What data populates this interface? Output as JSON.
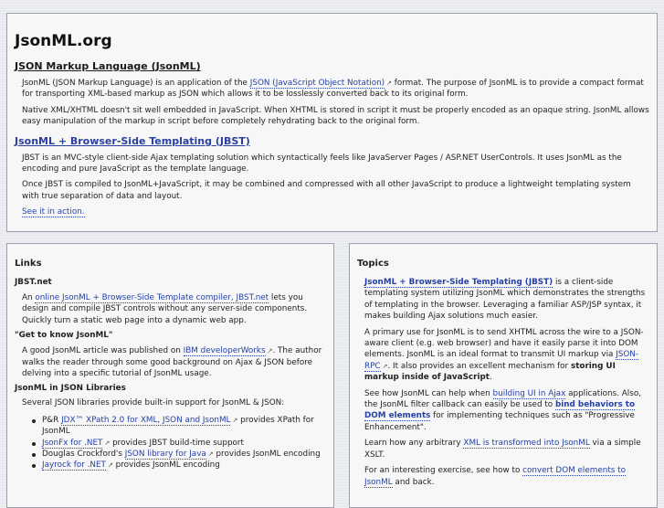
{
  "site": {
    "title": "JsonML.org"
  },
  "top": {
    "section1": {
      "heading": "JSON Markup Language (JsonML)",
      "p1_before": "JsonML (JSON Markup Language) is an application of the ",
      "p1_link": "JSON (JavaScript Object Notation)",
      "p1_after": " format. The purpose of JsonML is to provide a compact format for transporting XML-based markup as JSON which allows it to be losslessly converted back to its original form.",
      "p2": "Native XML/XHTML doesn't sit well embedded in JavaScript. When XHTML is stored in script it must be properly encoded as an opaque string. JsonML allows easy manipulation of the markup in script before completely rehydrating back to the original form."
    },
    "section2": {
      "heading": "JsonML + Browser-Side Templating (JBST)",
      "p1": "JBST is an MVC-style client-side Ajax templating solution which syntactically feels like JavaServer Pages / ASP.NET UserControls. It uses JsonML as the encoding and pure JavaScript as the template language.",
      "p2": "Once JBST is compiled to JsonML+JavaScript, it may be combined and compressed with all other JavaScript to produce a lightweight templating system with true separation of data and layout.",
      "link": "See it in action."
    }
  },
  "links": {
    "title": "Links",
    "jbst": {
      "heading": "JBST.net",
      "before": "An ",
      "link": "online JsonML + Browser-Side Template compiler, JBST.net",
      "after": " lets you design and compile JBST controls without any server-side components. Quickly turn a static web page into a dynamic web app."
    },
    "getknow": {
      "heading": "\"Get to know JsonML\"",
      "before": "A good JsonML article was published on ",
      "link": "IBM developerWorks",
      "after": ". The author walks the reader through some good background on Ajax & JSON before delving into a specific tutorial of JsonML usage."
    },
    "libs": {
      "heading": "JsonML in JSON Libraries",
      "intro": "Several JSON libraries provide built-in support for JsonML & JSON:",
      "items": [
        {
          "before": "P&R ",
          "link": "JDX™ XPath 2.0 for XML, JSON and JsonML",
          "after": " provides XPath for JsonML"
        },
        {
          "before": "",
          "link": "JsonFx for .NET",
          "after": " provides JBST build-time support"
        },
        {
          "before": "Douglas Crockford's ",
          "link": "JSON library for Java",
          "after": " provides JsonML encoding"
        },
        {
          "before": "",
          "link": "Jayrock for .NET",
          "after": " provides JsonML encoding"
        }
      ]
    }
  },
  "topics": {
    "title": "Topics",
    "p1": {
      "link": "JsonML + Browser-Side Templating (JBST)",
      "after": " is a client-side templating system utilizing JsonML which demonstrates the strengths of templating in the browser. Leveraging a familiar ASP/JSP syntax, it makes building Ajax solutions much easier."
    },
    "p2": {
      "before": "A primary use for JsonML is to send XHTML across the wire to a JSON-aware client (e.g. web browser) and have it easily parse it into DOM elements. JsonML is an ideal format to transmit UI markup via ",
      "link": "JSON-RPC",
      "mid": ". It also provides an excellent mechanism for ",
      "bold": "storing UI markup inside of JavaScript",
      "after": "."
    },
    "p3": {
      "before": "See how JsonML can help when ",
      "link": "building UI in Ajax",
      "mid": " applications. Also, the JsonML filter callback can easily be used to ",
      "link2": "bind behaviors to DOM elements",
      "after": " for implementing techniques such as \"Progressive Enhancement\"."
    },
    "p4": {
      "before": "Learn how any arbitrary ",
      "link": "XML is transformed into JsonML",
      "after": " via a simple XSLT."
    },
    "p5": {
      "before": "For an interesting exercise, see how to ",
      "link": "convert DOM elements to JsonML",
      "after": " and back."
    }
  },
  "icons": {
    "external": "external-link-icon"
  }
}
